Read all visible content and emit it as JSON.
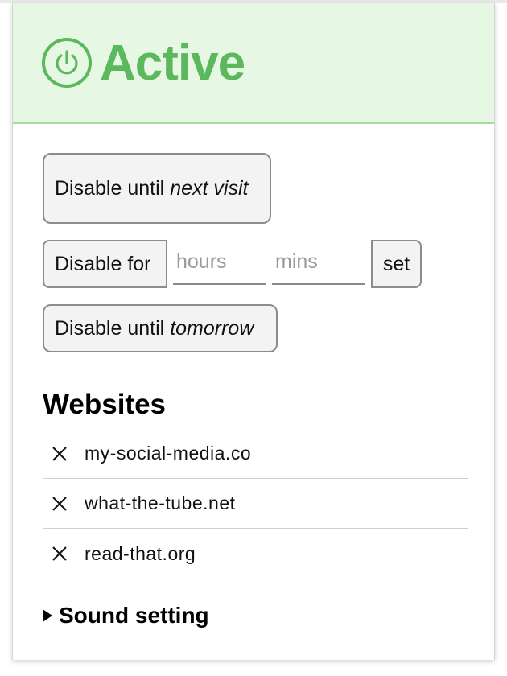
{
  "colors": {
    "accent": "#5cb85c",
    "header_bg": "#e6f8e3"
  },
  "header": {
    "status_text": "Active",
    "icon": "power-icon"
  },
  "actions": {
    "disable_next_visit": {
      "prefix": "Disable until",
      "emphasis": "next visit"
    },
    "disable_for": {
      "label": "Disable for",
      "hours_placeholder": "hours",
      "mins_placeholder": "mins",
      "hours_value": "",
      "mins_value": "",
      "set_label": "set"
    },
    "disable_tomorrow": {
      "prefix": "Disable until",
      "emphasis": "tomorrow"
    }
  },
  "websites": {
    "heading": "Websites",
    "remove_icon": "close-icon",
    "items": [
      {
        "name": "my-social-media.co"
      },
      {
        "name": "what-the-tube.net"
      },
      {
        "name": "read-that.org"
      }
    ]
  },
  "sound_setting": {
    "label": "Sound setting",
    "expanded": false
  }
}
